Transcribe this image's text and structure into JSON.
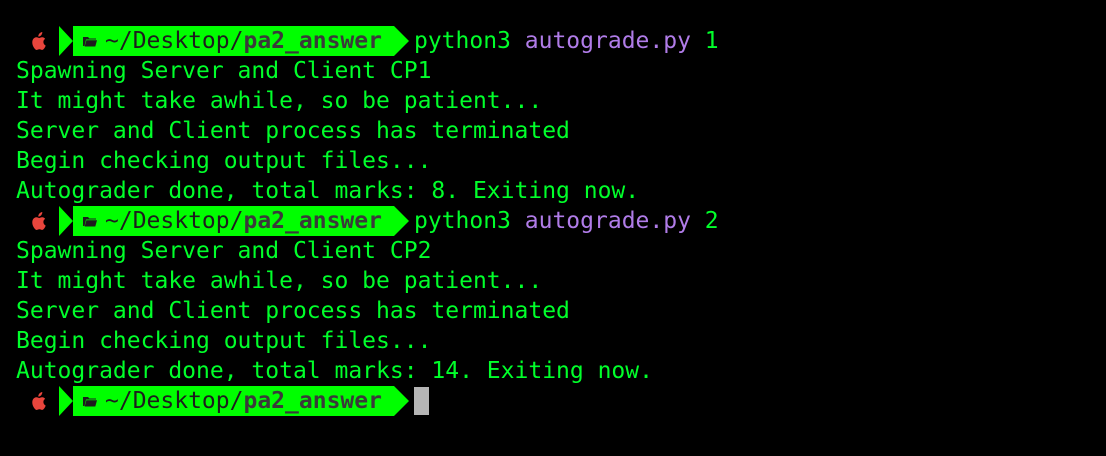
{
  "colors": {
    "background": "#000000",
    "output_text": "#00ff2a",
    "prompt_segment": "#00ff00",
    "command_arg": "#b07ce8",
    "apple_icon": "#e8453c",
    "cursor": "#b5b5b5"
  },
  "prompt": {
    "path_prefix": "~/Desktop/",
    "path_dir": "pa2_answer",
    "icons": [
      "apple-icon",
      "folder-icon"
    ]
  },
  "blocks": [
    {
      "command": "python3",
      "script": "autograde.py",
      "argument": "1",
      "output": [
        "Spawning Server and Client CP1",
        "It might take awhile, so be patient...",
        "Server and Client process has terminated",
        "Begin checking output files...",
        "Autograder done, total marks: 8. Exiting now."
      ]
    },
    {
      "command": "python3",
      "script": "autograde.py",
      "argument": "2",
      "output": [
        "Spawning Server and Client CP2",
        "It might take awhile, so be patient...",
        "Server and Client process has terminated",
        "Begin checking output files...",
        "Autograder done, total marks: 14. Exiting now."
      ]
    }
  ]
}
